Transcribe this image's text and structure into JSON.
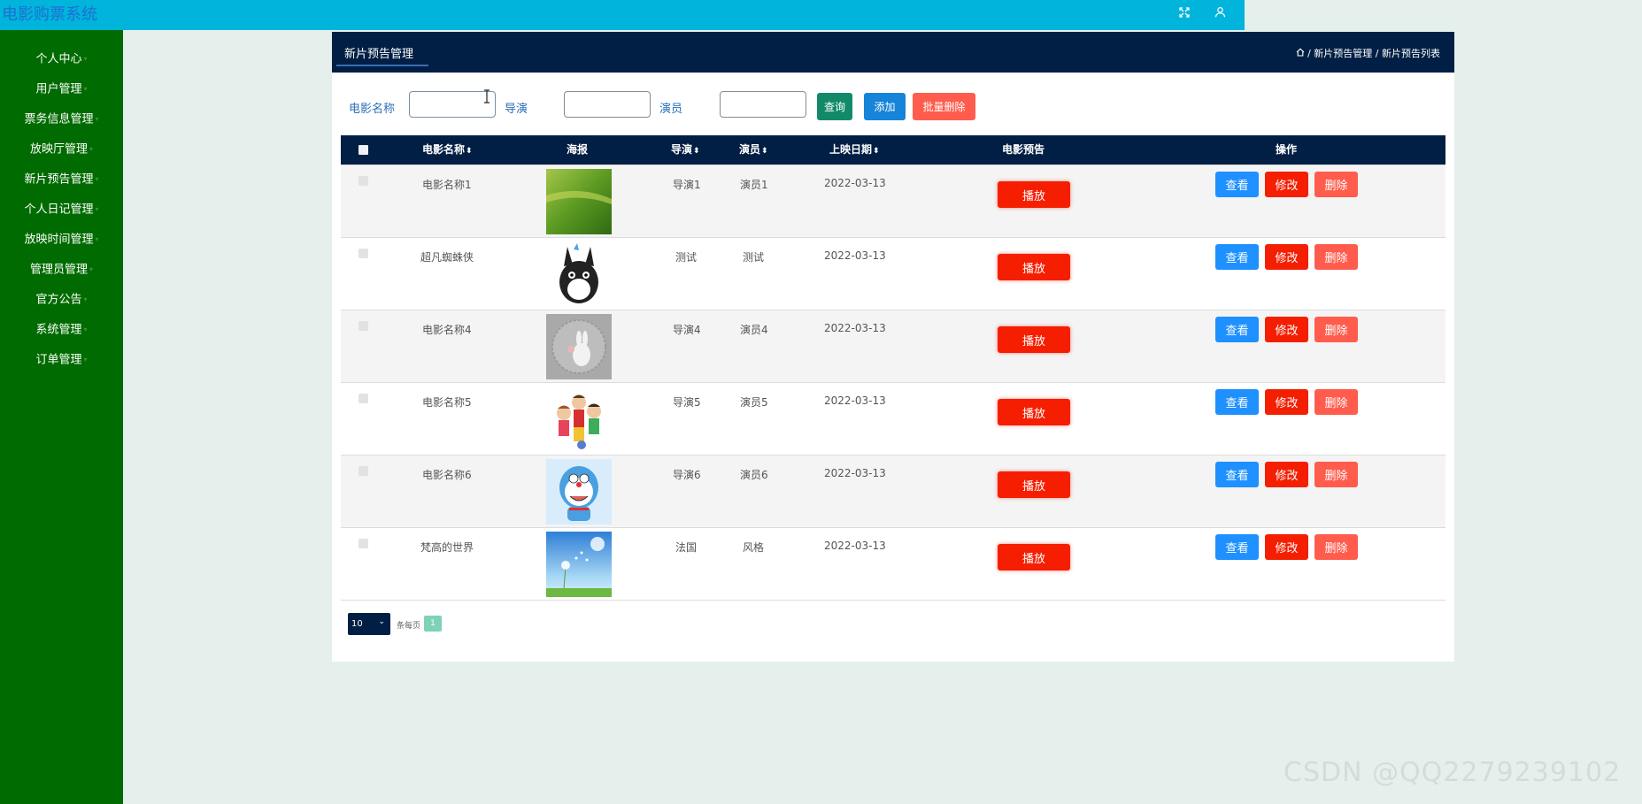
{
  "app": {
    "title": "电影购票系统",
    "icons": [
      "fullscreen-icon",
      "user-icon"
    ]
  },
  "sidebar": {
    "items": [
      {
        "label": "个人中心"
      },
      {
        "label": "用户管理"
      },
      {
        "label": "票务信息管理"
      },
      {
        "label": "放映厅管理"
      },
      {
        "label": "新片预告管理"
      },
      {
        "label": "个人日记管理"
      },
      {
        "label": "放映时间管理"
      },
      {
        "label": "管理员管理"
      },
      {
        "label": "官方公告"
      },
      {
        "label": "系统管理"
      },
      {
        "label": "订单管理"
      }
    ]
  },
  "header": {
    "tab": "新片预告管理",
    "breadcrumb": "/ 新片预告管理 / 新片预告列表"
  },
  "search": {
    "name_label": "电影名称",
    "director_label": "导演",
    "actor_label": "演员",
    "name_value": "",
    "director_value": "",
    "actor_value": "",
    "query_button": "查询",
    "add_button": "添加",
    "batch_delete_button": "批量删除"
  },
  "table": {
    "columns": [
      "电影名称",
      "海报",
      "导演",
      "演员",
      "上映日期",
      "电影预告",
      "操作"
    ],
    "rows": [
      {
        "name": "电影名称1",
        "director": "导演1",
        "actor": "演员1",
        "date": "2022-03-13",
        "poster": "grass-field"
      },
      {
        "name": "超凡蜘蛛侠",
        "director": "测试",
        "actor": "测试",
        "date": "2022-03-13",
        "poster": "totoro"
      },
      {
        "name": "电影名称4",
        "director": "导演4",
        "actor": "演员4",
        "date": "2022-03-13",
        "poster": "rabbit-sketch"
      },
      {
        "name": "电影名称5",
        "director": "导演5",
        "actor": "演员5",
        "date": "2022-03-13",
        "poster": "cartoon-kids"
      },
      {
        "name": "电影名称6",
        "director": "导演6",
        "actor": "演员6",
        "date": "2022-03-13",
        "poster": "doraemon"
      },
      {
        "name": "梵高的世界",
        "director": "法国",
        "actor": "风格",
        "date": "2022-03-13",
        "poster": "dandelion-sky"
      }
    ],
    "play_label": "播放",
    "view_label": "查看",
    "edit_label": "修改",
    "delete_label": "删除"
  },
  "pagination": {
    "page_size": "10",
    "per_page_label": "条每页",
    "current_page": "1"
  },
  "watermark": "CSDN @QQ2279239102",
  "colors": {
    "topbar": "#00b4dc",
    "sidebar": "#006b00",
    "header": "#011f44",
    "play": "#f51e00",
    "view": "#1e90ff",
    "edit": "#f41f00",
    "delete": "#ff5c4d",
    "query": "#128a6a",
    "add": "#1684d8",
    "batch_delete": "#ff5c4d"
  }
}
